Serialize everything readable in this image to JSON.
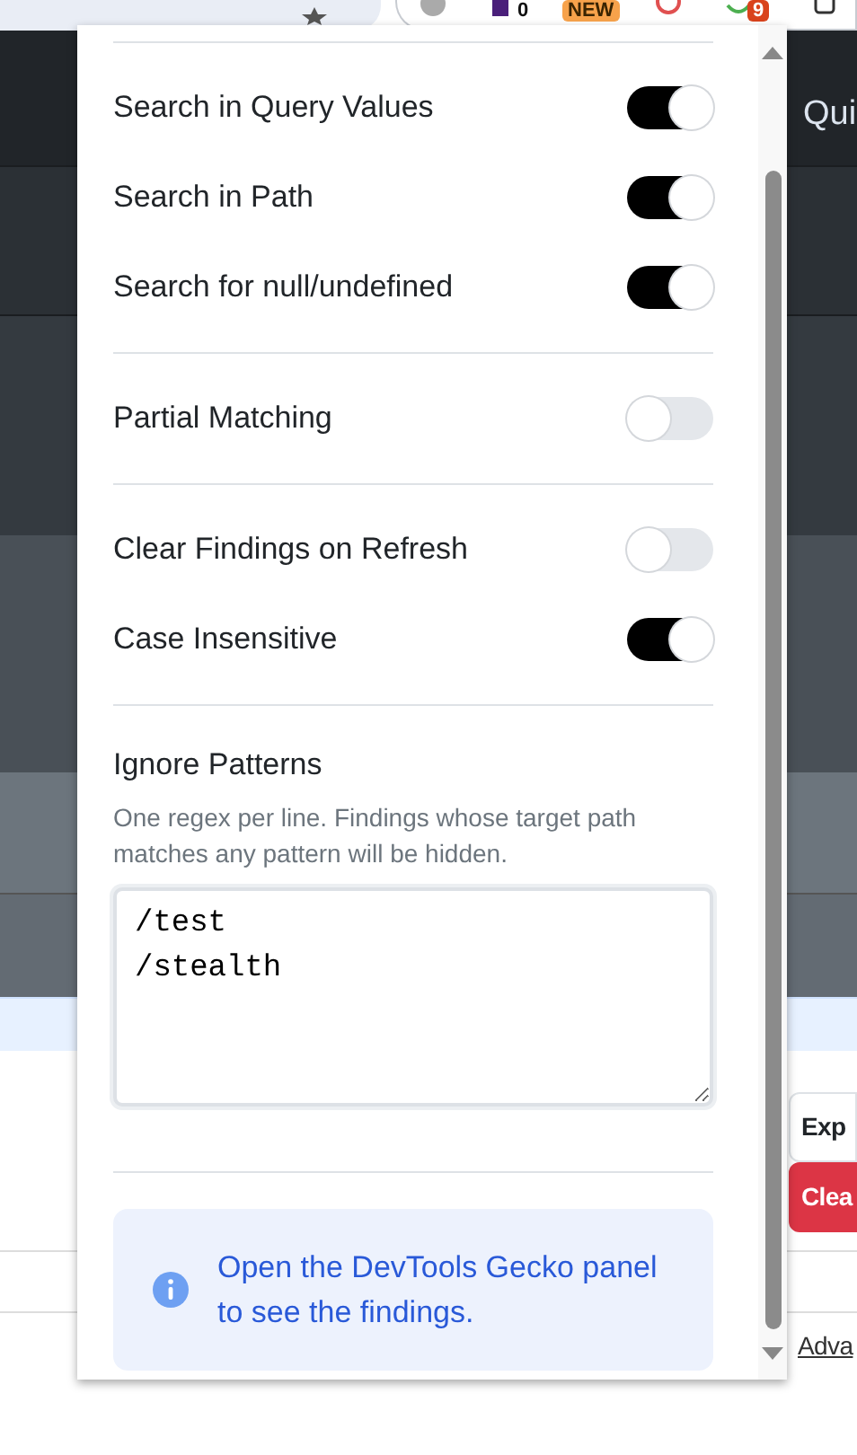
{
  "browser_toolbar": {
    "badges": [
      {
        "text": "0",
        "color": "#ffffff"
      },
      {
        "text": "NEW",
        "color": "#f7a24b"
      },
      {
        "text": "9",
        "color": "#d9431c"
      }
    ]
  },
  "page": {
    "nav_text": "Qui",
    "buttons": [
      {
        "label": "Exp",
        "kind": "outline"
      },
      {
        "label": "Clea",
        "kind": "danger"
      }
    ],
    "link": "Adva"
  },
  "popup": {
    "groups": [
      {
        "items": [
          {
            "label": "Search in Query Values",
            "on": true
          },
          {
            "label": "Search in Path",
            "on": true
          },
          {
            "label": "Search for null/undefined",
            "on": true
          }
        ]
      },
      {
        "items": [
          {
            "label": "Partial Matching",
            "on": false
          }
        ]
      },
      {
        "items": [
          {
            "label": "Clear Findings on Refresh",
            "on": false
          },
          {
            "label": "Case Insensitive",
            "on": true
          }
        ]
      }
    ],
    "ignore_patterns": {
      "title": "Ignore Patterns",
      "hint": "One regex per line. Findings whose target path matches any pattern will be hidden.",
      "value": "/test\n/stealth"
    },
    "info": "Open the DevTools Gecko panel to see the findings."
  }
}
